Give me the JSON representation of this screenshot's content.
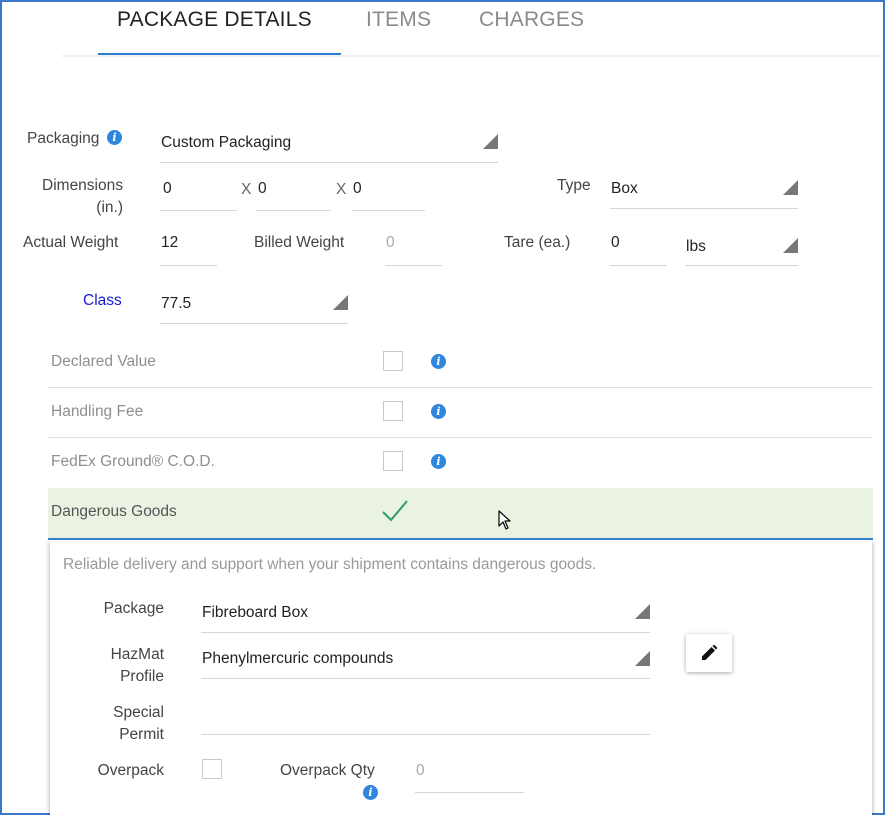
{
  "tabs": [
    {
      "label": "PACKAGE DETAILS",
      "active": true
    },
    {
      "label": "ITEMS",
      "active": false
    },
    {
      "label": "CHARGES",
      "active": false
    }
  ],
  "form": {
    "packaging_label": "Packaging",
    "packaging_value": "Custom Packaging",
    "dimensions_label_1": "Dimensions",
    "dimensions_label_2": "(in.)",
    "dim_length": "0",
    "dim_width": "0",
    "dim_height": "0",
    "dim_sep": "X",
    "type_label": "Type",
    "type_value": "Box",
    "actual_weight_label": "Actual Weight",
    "actual_weight_value": "12",
    "billed_weight_label": "Billed Weight",
    "billed_weight_value": "0",
    "tare_label": "Tare (ea.)",
    "tare_value": "0",
    "unit_value": "lbs",
    "class_label": "Class",
    "class_value": "77.5"
  },
  "options": [
    {
      "label": "Declared Value",
      "checked": false
    },
    {
      "label": "Handling Fee",
      "checked": false
    },
    {
      "label": "FedEx Ground® C.O.D.",
      "checked": false
    }
  ],
  "dangerous_goods": {
    "label": "Dangerous Goods",
    "checked": true,
    "description": "Reliable delivery and support when your shipment contains dangerous goods.",
    "package_label": "Package",
    "package_value": "Fibreboard Box",
    "hazmat_label_1": "HazMat",
    "hazmat_label_2": "Profile",
    "hazmat_value": "Phenylmercuric compounds",
    "special_permit_label_1": "Special",
    "special_permit_label_2": "Permit",
    "special_permit_value": "",
    "overpack_label": "Overpack",
    "overpack_qty_label": "Overpack Qty",
    "overpack_qty_value": "0"
  },
  "colors": {
    "accent": "#2f7fd1",
    "info_icon": "#2e86de",
    "class_link": "#1a1ad6",
    "dg_highlight": "#eaf3e2",
    "check_green": "#2e9a6e"
  },
  "icons": [
    "info-icon",
    "dropdown-triangle-icon",
    "checkmark-icon",
    "pencil-icon",
    "mouse-cursor-icon"
  ]
}
